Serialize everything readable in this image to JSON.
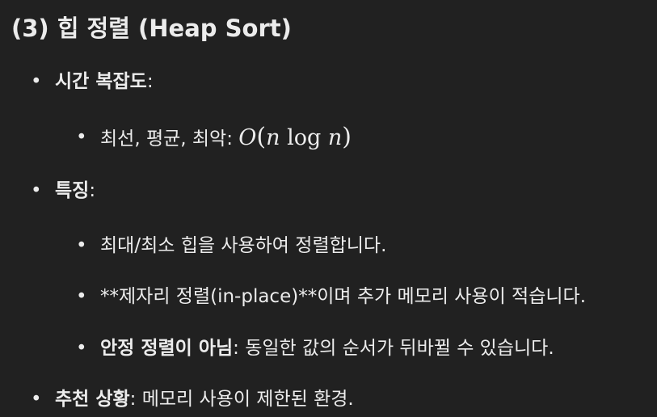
{
  "heading": "(3) 힙 정렬 (Heap Sort)",
  "bullet_glyph": "•",
  "items": [
    {
      "label": "시간 복잡도",
      "suffix": ":",
      "children": [
        {
          "text": "최선, 평균, 최악: ",
          "math": {
            "O": "O",
            "lparen": "(",
            "n1": "n",
            "log": "log",
            "n2": "n",
            "rparen": ")"
          }
        }
      ]
    },
    {
      "label": "특징",
      "suffix": ":",
      "children": [
        {
          "text": "최대/최소 힙을 사용하여 정렬합니다."
        },
        {
          "text": "**제자리 정렬(in-place)**이며 추가 메모리 사용이 적습니다."
        },
        {
          "bold": "안정 정렬이 아님",
          "text": ": 동일한 값의 순서가 뒤바뀔 수 있습니다."
        }
      ]
    },
    {
      "label": "추천 상황",
      "suffix": ": 메모리 사용이 제한된 환경."
    }
  ]
}
